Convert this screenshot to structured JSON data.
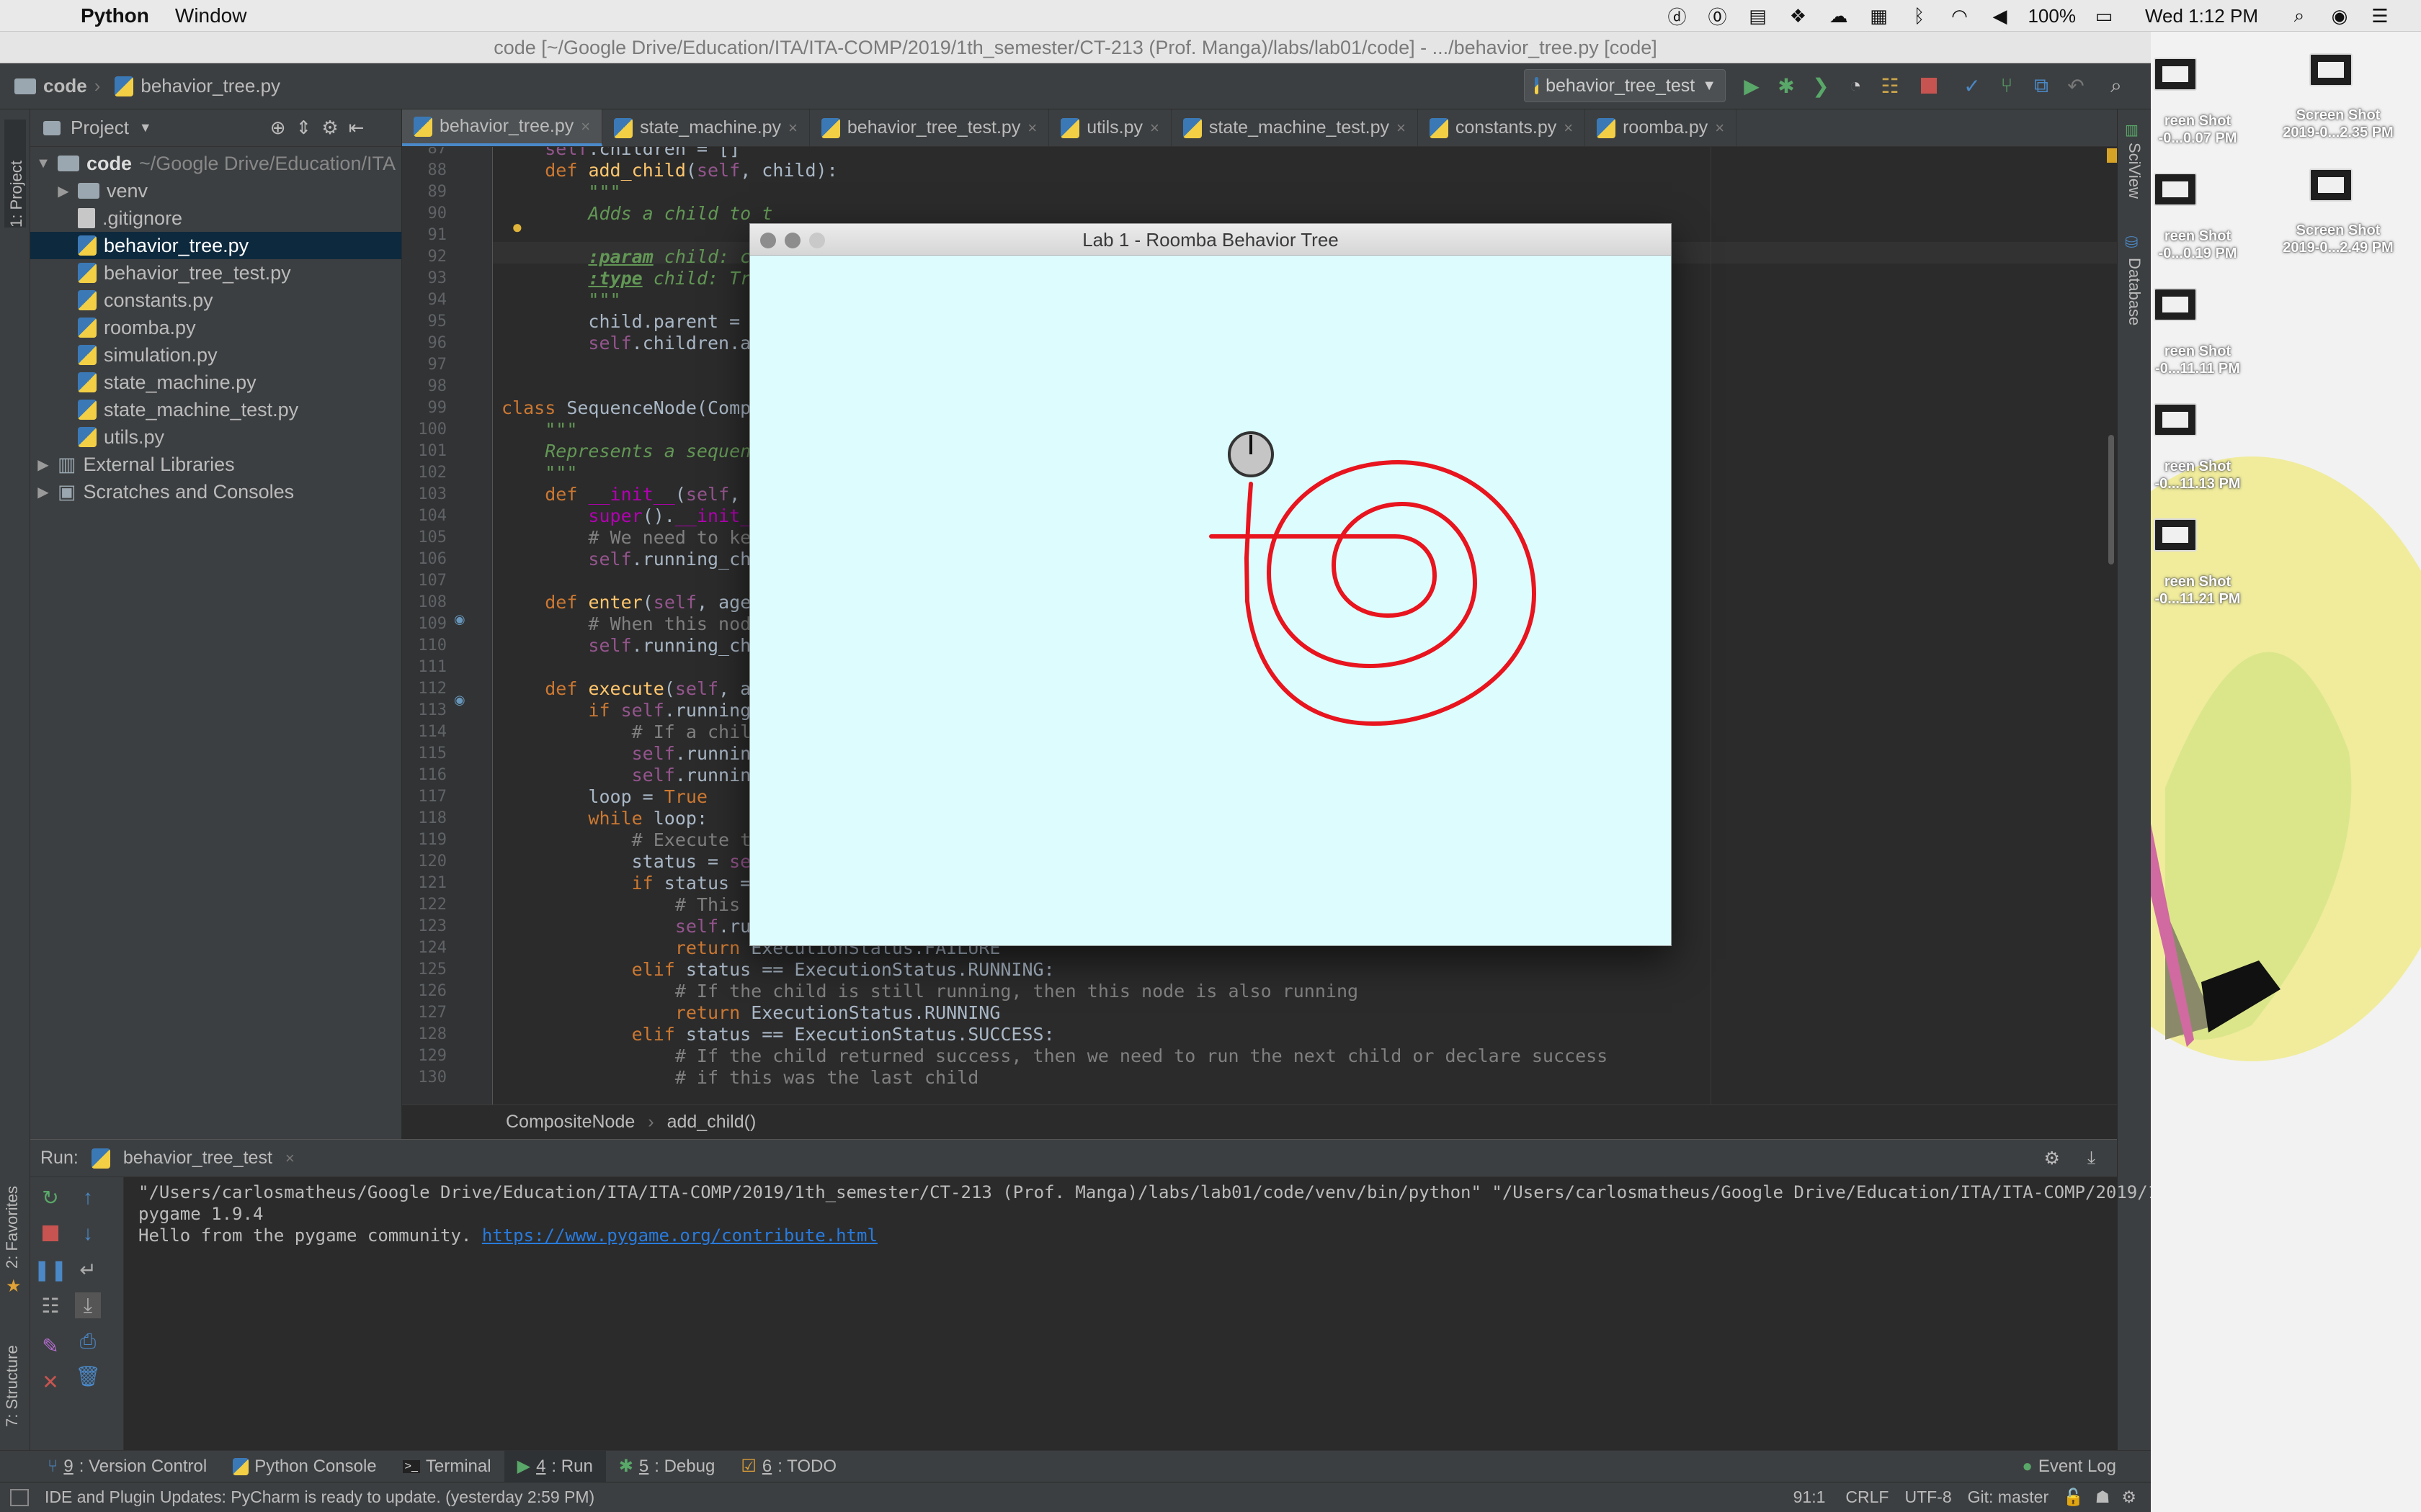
{
  "menubar": {
    "app_name": "Python",
    "menu_items": [
      "Window"
    ],
    "battery": "100%",
    "clock": "Wed 1:12 PM"
  },
  "window_title": "code [~/Google Drive/Education/ITA/ITA-COMP/2019/1th_semester/CT-213 (Prof. Manga)/labs/lab01/code] - .../behavior_tree.py [code]",
  "navbar": {
    "crumbs": [
      "code",
      "behavior_tree.py"
    ],
    "run_config": "behavior_tree_test"
  },
  "tool_windows": {
    "project": "1: Project",
    "favorites": "2: Favorites",
    "structure": "7: Structure",
    "sciview": "SciView",
    "database": "Database"
  },
  "project": {
    "header": "Project",
    "root_name": "code",
    "root_path": "~/Google Drive/Education/ITA",
    "items": [
      {
        "label": "venv",
        "kind": "folder"
      },
      {
        "label": ".gitignore",
        "kind": "file"
      },
      {
        "label": "behavior_tree.py",
        "kind": "py"
      },
      {
        "label": "behavior_tree_test.py",
        "kind": "py"
      },
      {
        "label": "constants.py",
        "kind": "py"
      },
      {
        "label": "roomba.py",
        "kind": "py"
      },
      {
        "label": "simulation.py",
        "kind": "py"
      },
      {
        "label": "state_machine.py",
        "kind": "py"
      },
      {
        "label": "state_machine_test.py",
        "kind": "py"
      },
      {
        "label": "utils.py",
        "kind": "py"
      }
    ],
    "external": "External Libraries",
    "scratches": "Scratches and Consoles"
  },
  "tabs": [
    "behavior_tree.py",
    "state_machine.py",
    "behavior_tree_test.py",
    "utils.py",
    "state_machine_test.py",
    "constants.py",
    "roomba.py"
  ],
  "editor": {
    "line_numbers": [
      "87",
      "88",
      "89",
      "90",
      "91",
      "92",
      "93",
      "94",
      "95",
      "96",
      "97",
      "98",
      "99",
      "100",
      "101",
      "102",
      "103",
      "104",
      "105",
      "106",
      "107",
      "108",
      "109",
      "110",
      "111",
      "112",
      "113",
      "114",
      "115",
      "116",
      "117",
      "118",
      "119",
      "120",
      "121",
      "122",
      "123",
      "124",
      "125",
      "126",
      "127",
      "128",
      "129",
      "130"
    ],
    "breadcrumb": [
      "CompositeNode",
      "add_child()"
    ]
  },
  "run": {
    "label": "Run:",
    "config": "behavior_tree_test",
    "console": [
      "\"/Users/carlosmatheus/Google Drive/Education/ITA/ITA-COMP/2019/1th_semester/CT-213 (Prof. Manga)/labs/lab01/code/venv/bin/python\" \"/Users/carlosmatheus/Google Drive/Education/ITA/ITA-COMP/2019/1th_",
      "pygame 1.9.4"
    ],
    "hello": "Hello from the pygame community. ",
    "link": "https://www.pygame.org/contribute.html"
  },
  "bottom_tabs": [
    {
      "key": "9",
      "label": ": Version Control"
    },
    {
      "key": "",
      "label": "Python Console"
    },
    {
      "key": "",
      "label": "Terminal"
    },
    {
      "key": "4",
      "label": ": Run"
    },
    {
      "key": "5",
      "label": ": Debug"
    },
    {
      "key": "6",
      "label": ": TODO"
    }
  ],
  "event_log": "Event Log",
  "status": {
    "message": "IDE and Plugin Updates: PyCharm is ready to update. (yesterday 2:59 PM)",
    "position": "91:1",
    "line_sep": "CRLF",
    "encoding": "UTF-8",
    "git": "Git: master"
  },
  "pygame_window": {
    "title": "Lab 1 - Roomba Behavior Tree",
    "background": "#dcfcfe",
    "path_color": "#e8141e"
  },
  "desktop_icons": [
    {
      "label1": "reen Shot",
      "label2": "-0...0.07 PM"
    },
    {
      "label1": "Screen Shot",
      "label2": "2019-0...2.35 PM"
    },
    {
      "label1": "reen Shot",
      "label2": "-0...0.19 PM"
    },
    {
      "label1": "Screen Shot",
      "label2": "2019-0...2.49 PM"
    },
    {
      "label1": "reen Shot",
      "label2": "-0...11.11 PM"
    },
    {
      "label1": "reen Shot",
      "label2": "-0...11.13 PM"
    },
    {
      "label1": "reen Shot",
      "label2": "-0...11.21 PM"
    }
  ],
  "colors": {
    "ide_bg": "#2b2b2b",
    "panel_bg": "#3c3f41",
    "selection": "#0d293e",
    "accent": "#4a88c7"
  }
}
